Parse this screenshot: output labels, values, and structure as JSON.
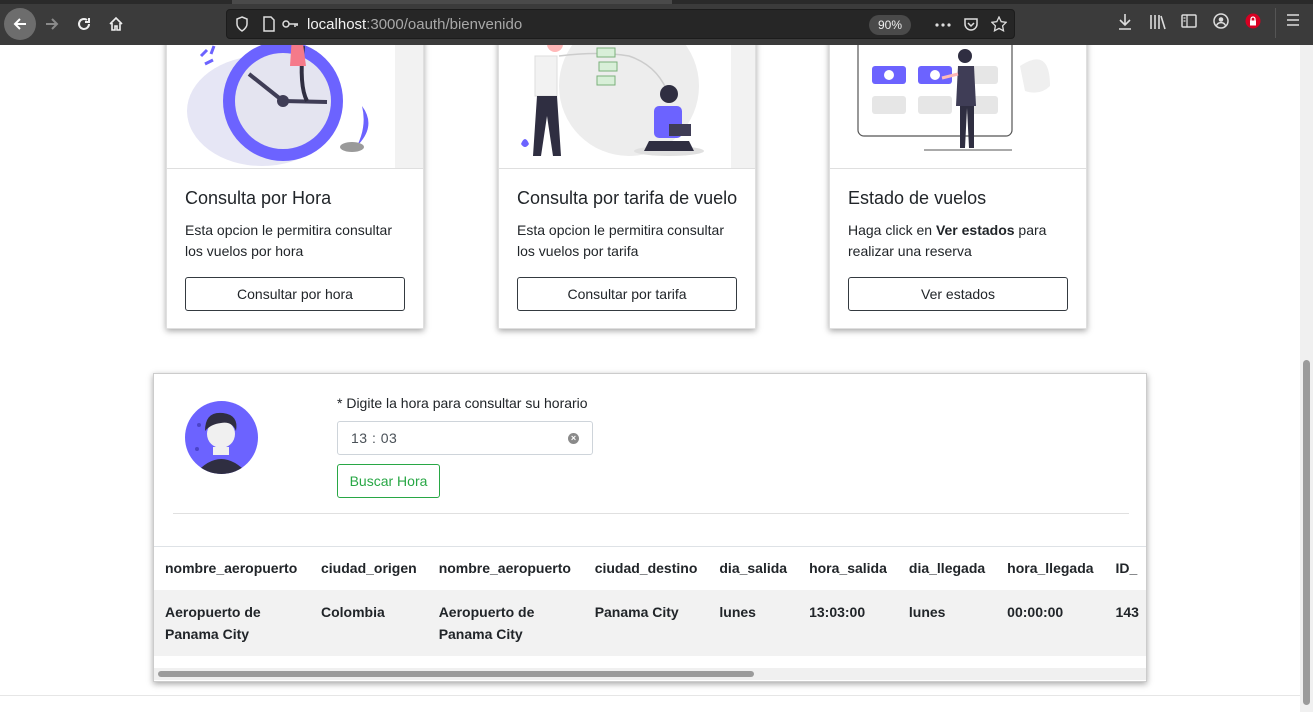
{
  "browser": {
    "url_host": "localhost",
    "url_path": ":3000/oauth/bienvenido",
    "zoom": "90%"
  },
  "cards": [
    {
      "title": "Consulta por Hora",
      "text": "Esta opcion le permitira consultar los vuelos por hora",
      "button": "Consultar por hora"
    },
    {
      "title": "Consulta por tarifa de vuelo",
      "text": "Esta opcion le permitira consultar los vuelos por tarifa",
      "button": "Consultar por tarifa"
    },
    {
      "title": "Estado de vuelos",
      "text_before": "Haga click en ",
      "text_bold": "Ver estados",
      "text_after": " para realizar una reserva",
      "button": "Ver estados"
    }
  ],
  "hour_form": {
    "label": "* Digite la hora para consultar su horario",
    "value": "13 : 03",
    "button": "Buscar Hora"
  },
  "table": {
    "headers": [
      "nombre_aeropuerto",
      "ciudad_origen",
      "nombre_aeropuerto",
      "ciudad_destino",
      "dia_salida",
      "hora_salida",
      "dia_llegada",
      "hora_llegada",
      "ID_"
    ],
    "row": [
      "Aeropuerto de Panama City",
      "Colombia",
      "Aeropuerto de Panama City",
      "Panama City",
      "lunes",
      "13:03:00",
      "lunes",
      "00:00:00",
      "143"
    ]
  },
  "colors": {
    "accent": "#6c63ff",
    "success": "#28a745"
  }
}
